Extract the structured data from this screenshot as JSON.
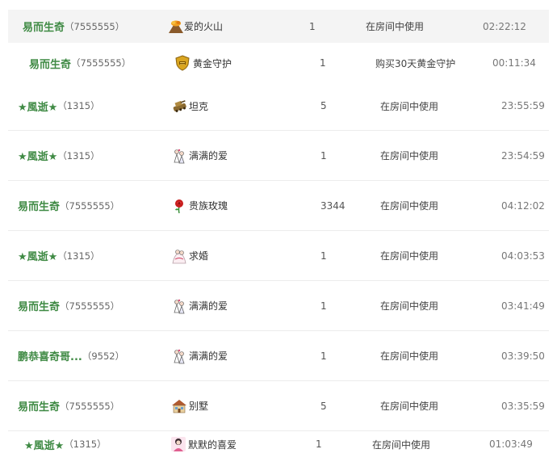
{
  "rows": [
    {
      "user": "易而生奇",
      "uid": "（7555555）",
      "gift": "爱的火山",
      "icon": "volcano-icon",
      "count": "1",
      "action": "在房间中使用",
      "time": "02:22:12"
    },
    {
      "user": "易而生奇",
      "uid": "（7555555）",
      "gift": "黄金守护",
      "icon": "gold-shield-icon",
      "count": "1",
      "action": "购买30天黄金守护",
      "time": "00:11:34"
    },
    {
      "user": "★風逝★",
      "uid": "（1315）",
      "gift": "坦克",
      "icon": "tank-icon",
      "count": "5",
      "action": "在房间中使用",
      "time": "23:55:59"
    },
    {
      "user": "★風逝★",
      "uid": "（1315）",
      "gift": "满满的爱",
      "icon": "couple-icon",
      "count": "1",
      "action": "在房间中使用",
      "time": "23:54:59"
    },
    {
      "user": "易而生奇",
      "uid": "（7555555）",
      "gift": "贵族玫瑰",
      "icon": "rose-icon",
      "count": "3344",
      "action": "在房间中使用",
      "time": "04:12:02"
    },
    {
      "user": "★風逝★",
      "uid": "（1315）",
      "gift": "求婚",
      "icon": "proposal-icon",
      "count": "1",
      "action": "在房间中使用",
      "time": "04:03:53"
    },
    {
      "user": "易而生奇",
      "uid": "（7555555）",
      "gift": "满满的爱",
      "icon": "couple-icon",
      "count": "1",
      "action": "在房间中使用",
      "time": "03:41:49"
    },
    {
      "user": "鹏恭喜奇哥...",
      "uid": "（9552）",
      "gift": "满满的爱",
      "icon": "couple-icon",
      "count": "1",
      "action": "在房间中使用",
      "time": "03:39:50"
    },
    {
      "user": "易而生奇",
      "uid": "（7555555）",
      "gift": "别墅",
      "icon": "villa-icon",
      "count": "5",
      "action": "在房间中使用",
      "time": "03:35:59"
    },
    {
      "user": "★風逝★",
      "uid": "（1315）",
      "gift": "默默的喜爱",
      "icon": "silent-love-icon",
      "count": "1",
      "action": "在房间中使用",
      "time": "01:03:49"
    }
  ]
}
